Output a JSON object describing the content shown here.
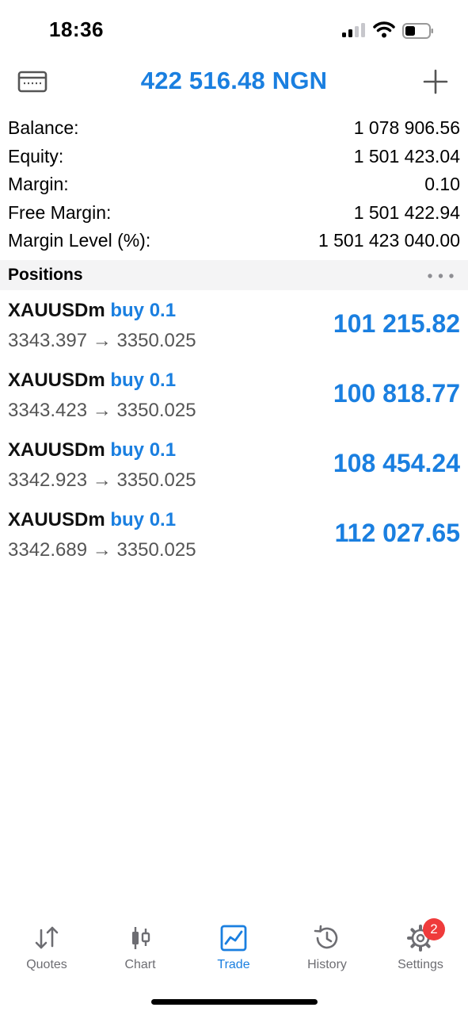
{
  "status_bar": {
    "time": "18:36"
  },
  "header": {
    "title": "422 516.48 NGN"
  },
  "summary": [
    {
      "label": "Balance:",
      "value": "1 078 906.56"
    },
    {
      "label": "Equity:",
      "value": "1 501 423.04"
    },
    {
      "label": "Margin:",
      "value": "0.10"
    },
    {
      "label": "Free Margin:",
      "value": "1 501 422.94"
    },
    {
      "label": "Margin Level (%):",
      "value": "1 501 423 040.00"
    }
  ],
  "positions": {
    "title": "Positions",
    "items": [
      {
        "symbol": "XAUUSDm",
        "side": "buy 0.1",
        "prices": "3343.397 → 3350.025",
        "profit": "101 215.82"
      },
      {
        "symbol": "XAUUSDm",
        "side": "buy 0.1",
        "prices": "3343.423 → 3350.025",
        "profit": "100 818.77"
      },
      {
        "symbol": "XAUUSDm",
        "side": "buy 0.1",
        "prices": "3342.923 → 3350.025",
        "profit": "108 454.24"
      },
      {
        "symbol": "XAUUSDm",
        "side": "buy 0.1",
        "prices": "3342.689 → 3350.025",
        "profit": "112 027.65"
      }
    ]
  },
  "tabs": [
    {
      "label": "Quotes",
      "icon": "quotes-arrows-icon"
    },
    {
      "label": "Chart",
      "icon": "candlestick-icon"
    },
    {
      "label": "Trade",
      "icon": "trade-chart-icon",
      "active": true
    },
    {
      "label": "History",
      "icon": "history-clock-icon"
    },
    {
      "label": "Settings",
      "icon": "gear-icon",
      "badge": "2"
    }
  ],
  "colors": {
    "accent": "#1a7fe0",
    "badge": "#ef3b3b",
    "inactive": "#6d6d72"
  }
}
